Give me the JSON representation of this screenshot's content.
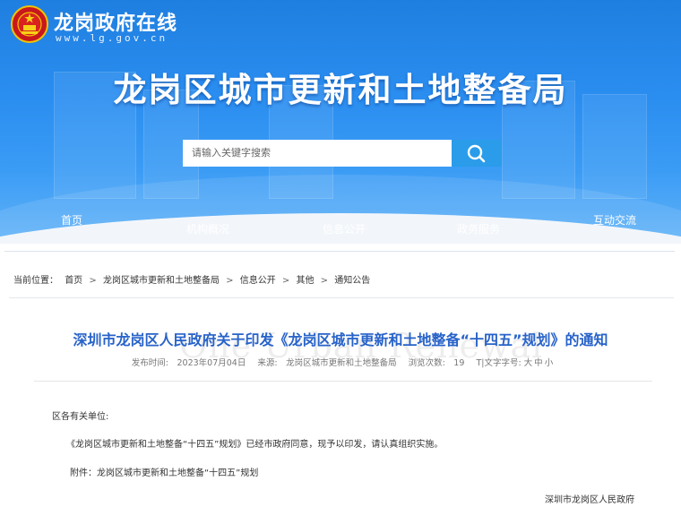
{
  "header": {
    "site_name": "龙岗政府在线",
    "site_url": "www.lg.gov.cn",
    "department": "龙岗区城市更新和土地整备局",
    "search_placeholder": "请输入关键字搜索"
  },
  "nav": {
    "items": [
      {
        "label": "首页"
      },
      {
        "label": "机构概况"
      },
      {
        "label": "信息公开"
      },
      {
        "label": "政务服务"
      },
      {
        "label": "互动交流"
      }
    ]
  },
  "breadcrumb": {
    "prefix": "当前位置：",
    "items": [
      "首页",
      "龙岗区城市更新和土地整备局",
      "信息公开",
      "其他",
      "通知公告"
    ],
    "separator": ">"
  },
  "article": {
    "title": "深圳市龙岗区人民政府关于印发《龙岗区城市更新和土地整备“十四五”规划》的通知",
    "watermark": "One Urban Renewal",
    "meta": {
      "published": "发布时间:　2023年07月04日",
      "source": "来源:　龙岗区城市更新和土地整备局",
      "views": "浏览次数:　19",
      "font_size_label": "T|文字字号:",
      "font_large": "大",
      "font_medium": "中",
      "font_small": "小"
    },
    "salutation": "区各有关单位:",
    "body": "《龙岗区城市更新和土地整备“十四五”规划》已经市政府同意，现予以印发，请认真组织实施。",
    "attachment": "附件：龙岗区城市更新和土地整备“十四五”规划",
    "signature": "深圳市龙岗区人民政府"
  },
  "colors": {
    "banner": "#2a8ef0",
    "title": "#2863c9",
    "search_button": "#2a9cea"
  }
}
